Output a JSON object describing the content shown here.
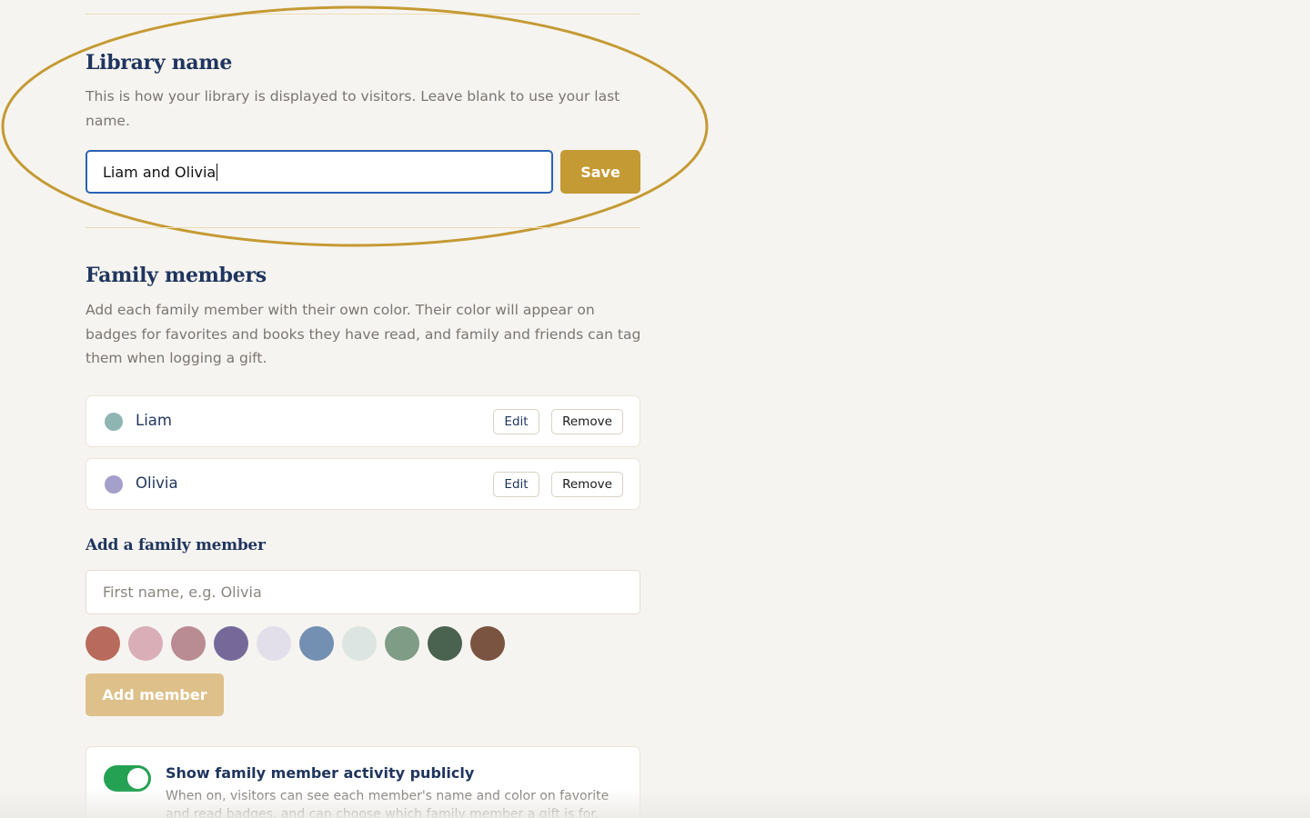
{
  "library_section": {
    "title": "Library name",
    "description": "This is how your library is displayed to visitors. Leave blank to use your last name.",
    "name_value": "Liam and Olivia",
    "save_label": "Save"
  },
  "family_section": {
    "title": "Family members",
    "description": "Add each family member with their own color. Their color will appear on badges for favorites and books they have read, and family and friends can tag them when logging a gift.",
    "members": [
      {
        "name": "Liam",
        "color": "#8fb5b3",
        "edit_label": "Edit",
        "remove_label": "Remove"
      },
      {
        "name": "Olivia",
        "color": "#a59fcc",
        "edit_label": "Edit",
        "remove_label": "Remove"
      }
    ]
  },
  "add_member": {
    "title": "Add a family member",
    "name_placeholder": "First name, e.g. Olivia",
    "swatches": [
      "#b86b5c",
      "#d9aeb6",
      "#b98b93",
      "#76699a",
      "#e3dfea",
      "#7390b3",
      "#dce5e2",
      "#7f9c86",
      "#4a6350",
      "#7a5440"
    ],
    "button_label": "Add member"
  },
  "public_toggle": {
    "title": "Show family member activity publicly",
    "description": "When on, visitors can see each member's name and color on favorite and read badges, and can choose which family member a gift is for.",
    "enabled": true,
    "color": "#24a152"
  },
  "accent_color": "#c49a34"
}
